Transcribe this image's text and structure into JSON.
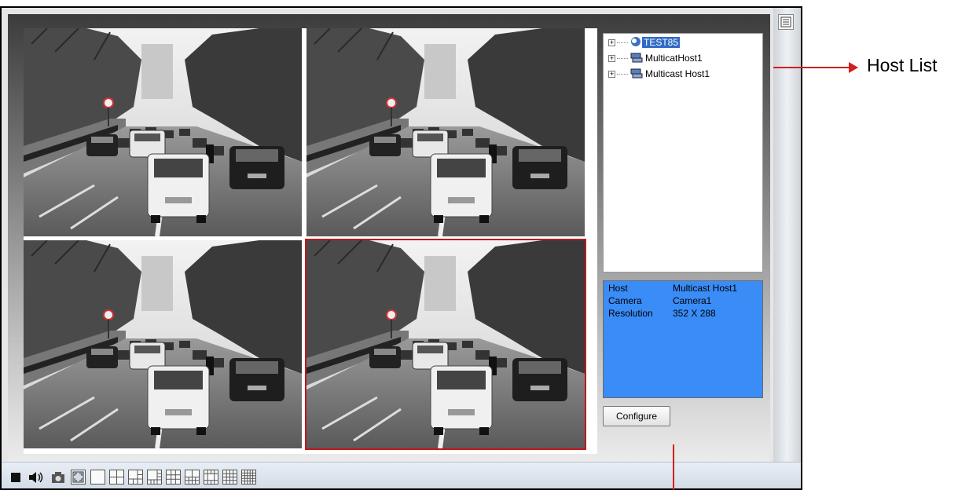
{
  "host_tree": [
    {
      "label": "TEST85",
      "selected": true,
      "icon": "globe-camera-icon"
    },
    {
      "label": "MulticatHost1",
      "selected": false,
      "icon": "network-host-icon"
    },
    {
      "label": "Multicast Host1",
      "selected": false,
      "icon": "network-host-icon"
    }
  ],
  "info": {
    "rows": [
      {
        "key": "Host",
        "value": "Multicast Host1"
      },
      {
        "key": "Camera",
        "value": "Camera1"
      },
      {
        "key": "Resolution",
        "value": "352 X 288"
      }
    ],
    "background_color": "#3a8cf7"
  },
  "configure_label": "Configure",
  "annotation": {
    "label": "Host List",
    "color": "#d21f1f"
  },
  "toolbar": {
    "icons": [
      "stop-icon",
      "speaker-icon",
      "snapshot-camera-icon",
      "fullscreen-icon",
      "layout-1-icon",
      "layout-4-icon",
      "layout-6-icon",
      "layout-8-icon",
      "layout-9-icon",
      "layout-10-icon",
      "layout-13-icon",
      "layout-16-icon",
      "layout-25-icon"
    ]
  },
  "video_tiles": [
    {
      "selected": false
    },
    {
      "selected": false
    },
    {
      "selected": false
    },
    {
      "selected": true
    }
  ],
  "selection_color": "#c01818"
}
